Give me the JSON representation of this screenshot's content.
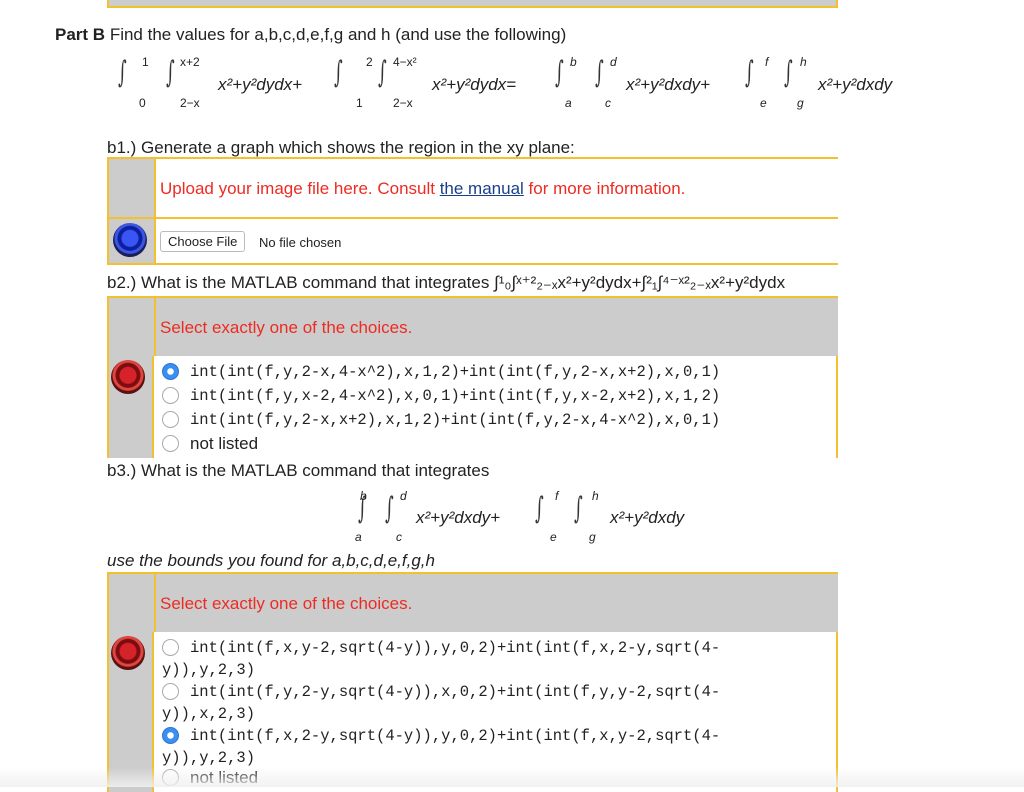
{
  "partB": {
    "label": "Part B",
    "prompt": "Find the values for a,b,c,d,e,f,g and h (and use the following)",
    "equation": {
      "int1": {
        "outer_lo": "0",
        "outer_hi": "1",
        "inner_lo": "2−x",
        "inner_hi": "x+2",
        "integrand": "x²+y²dydx+"
      },
      "int2": {
        "outer_lo": "1",
        "outer_hi": "2",
        "inner_lo": "2−x",
        "inner_hi": "4−x²",
        "integrand": "x²+y²dydx="
      },
      "int3": {
        "outer_lo": "a",
        "outer_hi": "b",
        "inner_lo": "c",
        "inner_hi": "d",
        "integrand": "x²+y²dxdy+"
      },
      "int4": {
        "outer_lo": "e",
        "outer_hi": "f",
        "inner_lo": "g",
        "inner_hi": "h",
        "integrand": "x²+y²dxdy"
      }
    }
  },
  "b1": {
    "question": "b1.) Generate a graph which shows the region in the xy plane:",
    "upload_prefix": "Upload your image file here. Consult ",
    "upload_link": "the manual",
    "upload_suffix": " for more information.",
    "choose_file": "Choose File",
    "file_status": "No file chosen",
    "status_color": "blue"
  },
  "b2": {
    "question": "b2.) What is the MATLAB command that integrates ∫¹₀∫ˣ⁺²₂₋ₓx²+y²dydx+∫²₁∫⁴⁻ˣ²₂₋ₓx²+y²dydx",
    "instruction": "Select exactly one of the choices.",
    "status_color": "red",
    "choices": [
      {
        "text": "int(int(f,y,2-x,4-x^2),x,1,2)+int(int(f,y,2-x,x+2),x,0,1)",
        "selected": true
      },
      {
        "text": "int(int(f,y,x-2,4-x^2),x,0,1)+int(int(f,y,x-2,x+2),x,1,2)",
        "selected": false
      },
      {
        "text": "int(int(f,y,2-x,x+2),x,1,2)+int(int(f,y,2-x,4-x^2),x,0,1)",
        "selected": false
      },
      {
        "text": "not listed",
        "selected": false
      }
    ]
  },
  "b3": {
    "question": "b3.) What is the MATLAB command that integrates",
    "equation": {
      "int1": {
        "outer_lo": "a",
        "outer_hi": "b",
        "inner_lo": "c",
        "inner_hi": "d",
        "integrand": "x²+y²dxdy+"
      },
      "int2": {
        "outer_lo": "e",
        "outer_hi": "f",
        "inner_lo": "g",
        "inner_hi": "h",
        "integrand": "x²+y²dxdy"
      }
    },
    "note": "use the bounds you found for a,b,c,d,e,f,g,h",
    "instruction": "Select exactly one of the choices.",
    "status_color": "red",
    "choices": [
      {
        "line1": "int(int(f,x,y-2,sqrt(4-y)),y,0,2)+int(int(f,x,2-y,sqrt(4-",
        "line2": "y)),y,2,3)",
        "selected": false
      },
      {
        "line1": "int(int(f,y,2-y,sqrt(4-y)),x,0,2)+int(int(f,y,y-2,sqrt(4-",
        "line2": "y)),x,2,3)",
        "selected": false
      },
      {
        "line1": "int(int(f,x,2-y,sqrt(4-y)),y,0,2)+int(int(f,x,y-2,sqrt(4-",
        "line2": "y)),y,2,3)",
        "selected": true
      },
      {
        "line1": "not listed",
        "line2": "",
        "selected": false
      }
    ]
  }
}
